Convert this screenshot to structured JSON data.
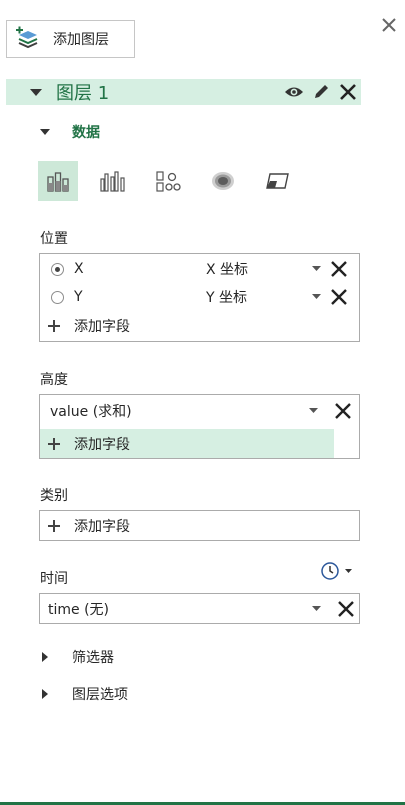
{
  "toolbar": {
    "add_layer_label": "添加图层"
  },
  "layer": {
    "name": "图层 1"
  },
  "data_section": {
    "title": "数据"
  },
  "viz_types": [
    {
      "icon": "stacked-column-icon",
      "selected": true
    },
    {
      "icon": "clustered-column-icon",
      "selected": false
    },
    {
      "icon": "bubble-icon",
      "selected": false
    },
    {
      "icon": "heatmap-icon",
      "selected": false
    },
    {
      "icon": "region-icon",
      "selected": false
    }
  ],
  "location": {
    "label": "位置",
    "fields": [
      {
        "name": "X",
        "type": "X 坐标",
        "selected": true
      },
      {
        "name": "Y",
        "type": "Y 坐标",
        "selected": false
      }
    ],
    "add_field": "添加字段"
  },
  "height": {
    "label": "高度",
    "field": "value (求和)",
    "add_field": "添加字段"
  },
  "category": {
    "label": "类别",
    "add_field": "添加字段"
  },
  "time": {
    "label": "时间",
    "field": "time (无)"
  },
  "filters": {
    "label": "筛选器"
  },
  "layer_options": {
    "label": "图层选项"
  },
  "colors": {
    "accent": "#217346",
    "highlight": "#d6efe2",
    "selected": "#cde8d8"
  }
}
